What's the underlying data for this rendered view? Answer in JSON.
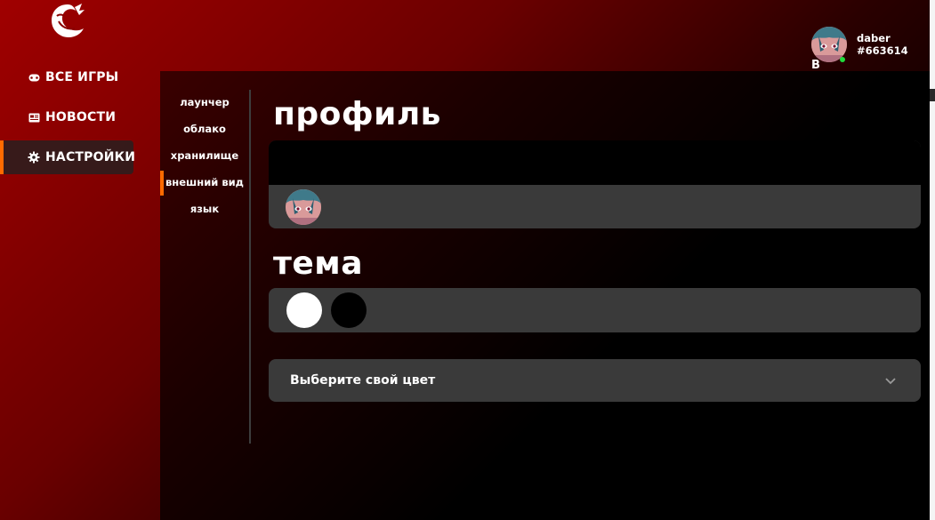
{
  "nav": {
    "items": [
      {
        "label": "ВСЕ ИГРЫ",
        "icon": "gamepad-icon"
      },
      {
        "label": "НОВОСТИ",
        "icon": "news-icon"
      },
      {
        "label": "НАСТРОЙКИ",
        "icon": "gear-icon",
        "active": true
      }
    ]
  },
  "user": {
    "name": "daber",
    "tag": "#663614",
    "initial": "B",
    "status": "online"
  },
  "settings_nav": {
    "items": [
      {
        "label": "лаунчер"
      },
      {
        "label": "облако"
      },
      {
        "label": "хранилище"
      },
      {
        "label": "внешний вид",
        "active": true
      },
      {
        "label": "язык"
      }
    ]
  },
  "profile": {
    "title": "профиль"
  },
  "theme": {
    "title": "тема",
    "swatches": [
      {
        "name": "light",
        "color": "#ffffff"
      },
      {
        "name": "dark",
        "color": "#000000"
      }
    ]
  },
  "color_select": {
    "placeholder": "Выберите свой цвет"
  },
  "colors": {
    "accent": "#ff6a00",
    "online": "#1fdc3c",
    "card": "#3a3a3a"
  }
}
